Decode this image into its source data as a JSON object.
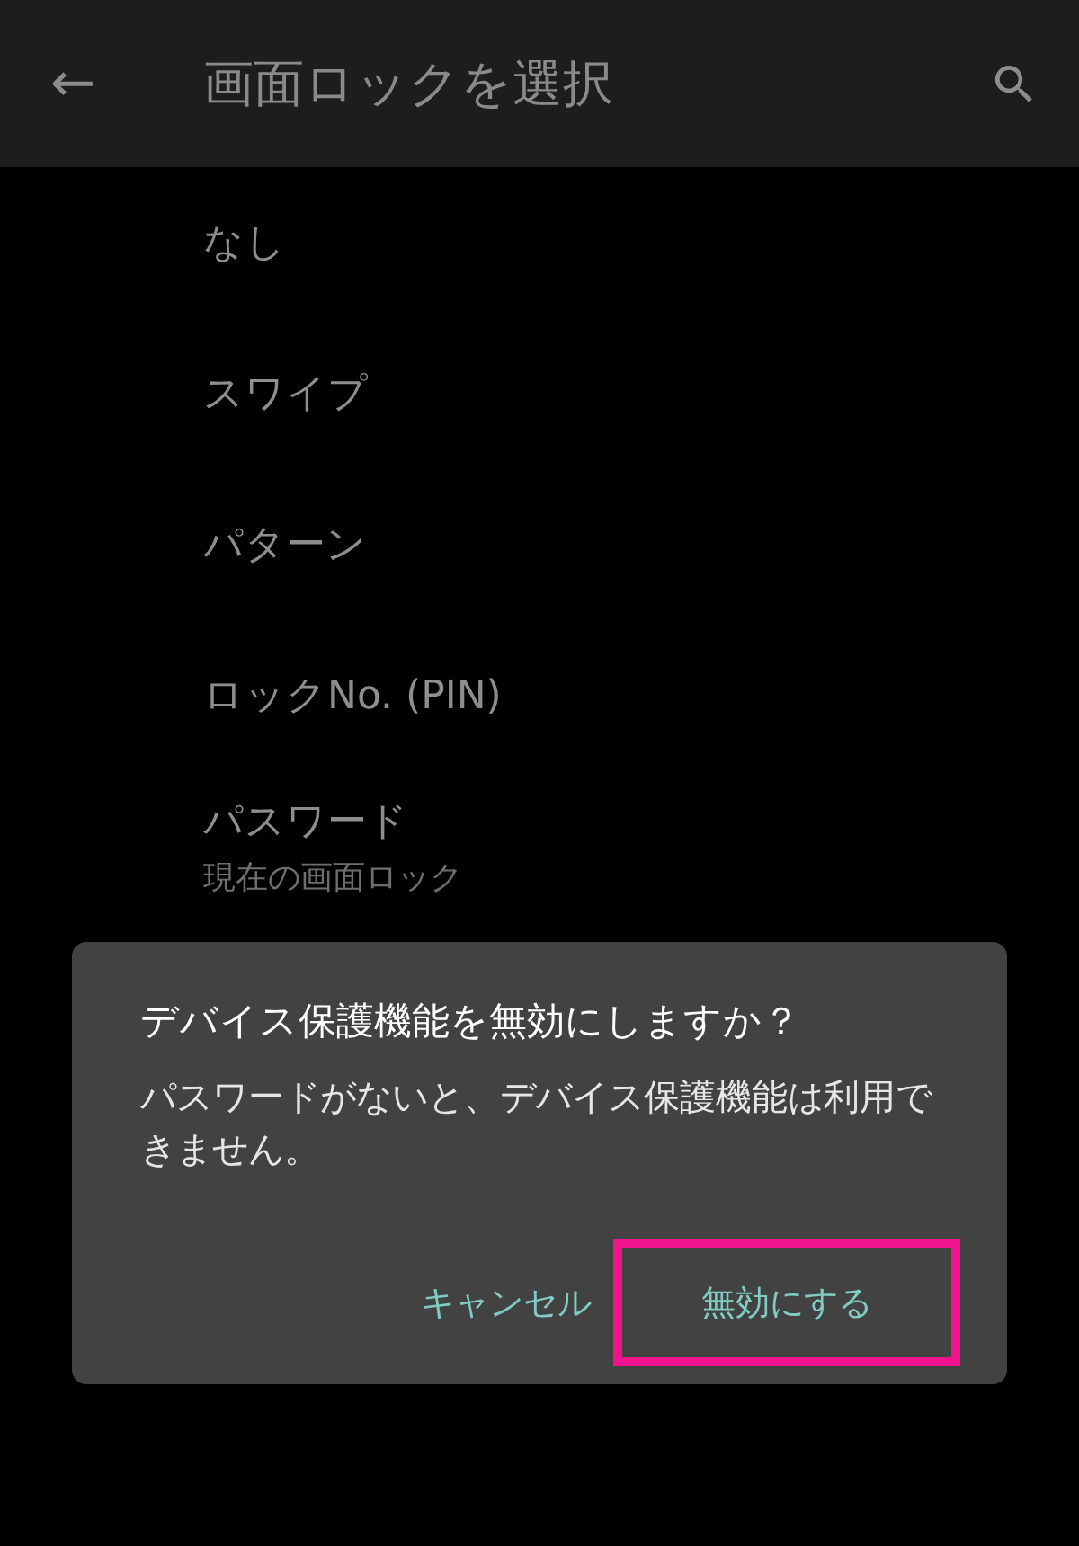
{
  "app_bar": {
    "back": "←",
    "title": "画面ロックを選択"
  },
  "options": [
    {
      "label": "なし"
    },
    {
      "label": "スワイプ"
    },
    {
      "label": "パターン"
    },
    {
      "label": "ロックNo. (PIN)"
    },
    {
      "label": "パスワード",
      "summary": "現在の画面ロック"
    }
  ],
  "dialog": {
    "title": "デバイス保護機能を無効にしますか？",
    "message": "パスワードがないと、デバイス保護機能は利用できません。",
    "buttons": [
      {
        "label": "キャンセル",
        "highlighted": false
      },
      {
        "label": "無効にする",
        "highlighted": true
      }
    ]
  }
}
